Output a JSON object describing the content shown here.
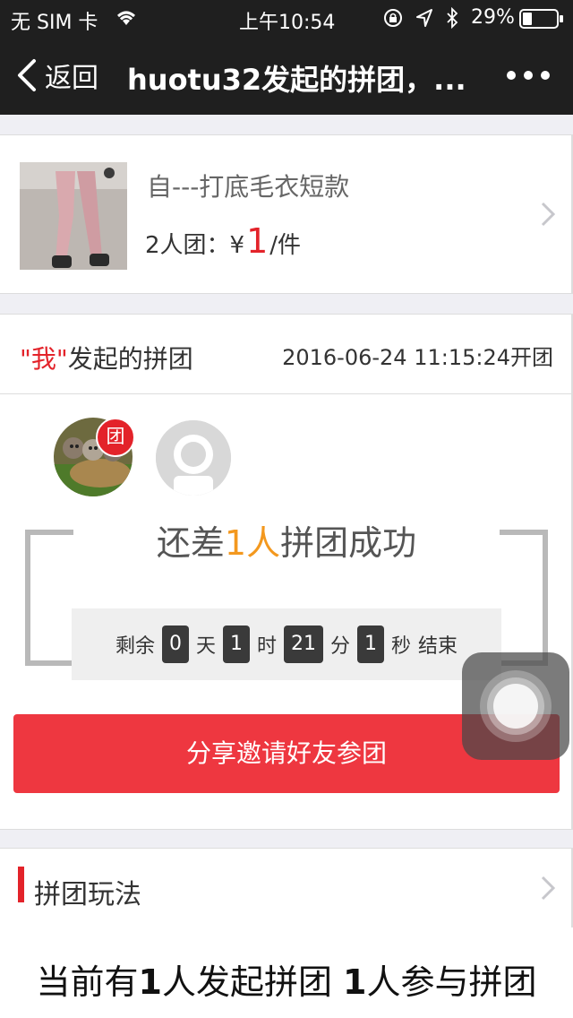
{
  "status_bar": {
    "carrier": "无 SIM 卡",
    "time": "上午10:54",
    "battery": "29%"
  },
  "nav": {
    "back_label": "返回",
    "title": "huotu32发起的拼团，..."
  },
  "product": {
    "name": "自---打底毛衣短款",
    "price_prefix": "2人团：¥",
    "price_value": "1",
    "price_unit": "/件"
  },
  "group": {
    "title_quote_open": "\"",
    "title_me": "我",
    "title_quote_close": "\"",
    "title_rest": "发起的拼团",
    "start_time": "2016-06-24 11:15:24开团",
    "leader_badge": "团",
    "need_prefix": "还差",
    "need_count": "1人",
    "need_suffix": "拼团成功",
    "countdown": {
      "remain_label": "剩余",
      "days": "0",
      "day_unit": "天",
      "hours": "1",
      "hour_unit": "时",
      "minutes": "21",
      "minute_unit": "分",
      "seconds": "1",
      "second_unit": "秒",
      "end_label": "结束"
    },
    "share_button": "分享邀请好友参团"
  },
  "rules": {
    "title": "拼团玩法"
  },
  "footer": {
    "p1": "当前有",
    "n1": "1",
    "p2": "人发起拼团 ",
    "n2": "1",
    "p3": "人参与拼团"
  },
  "colors": {
    "accent_red": "#e3232a",
    "highlight_orange": "#f3981e",
    "share_button": "#ee3740",
    "nav_bg": "#1f1f1f"
  }
}
